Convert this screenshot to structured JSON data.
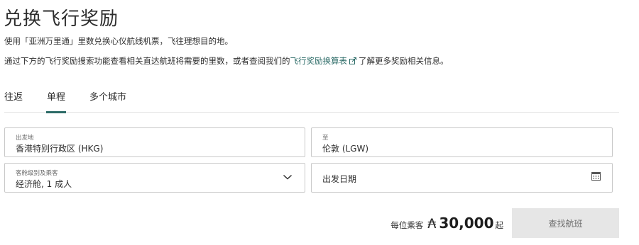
{
  "page": {
    "title": "兑换飞行奖励",
    "intro": "使用「亚洲万里通」里数兑换心仪航线机票，飞往理想目的地。",
    "desc_before": "通过下方的飞行奖励搜索功能查看相关直达航班将需要的里数，或者查阅我们的",
    "desc_link": "飞行奖励换算表",
    "desc_after": "了解更多奖励相关信息。"
  },
  "tabs": [
    {
      "label": "往返",
      "active": false
    },
    {
      "label": "单程",
      "active": true
    },
    {
      "label": "多个城市",
      "active": false
    }
  ],
  "form": {
    "origin": {
      "label": "出发地",
      "value": "香港特别行政区 (HKG)"
    },
    "destination": {
      "label": "至",
      "value": "伦敦 (LGW)"
    },
    "cabin": {
      "label": "客舱级别及乘客",
      "value": "经济舱, 1 成人"
    },
    "date": {
      "placeholder": "出发日期"
    }
  },
  "price": {
    "prefix": "每位乘客",
    "currency_symbol": "₳",
    "amount": "30,000",
    "suffix": "起"
  },
  "search_button": {
    "label": "查找航班"
  },
  "colors": {
    "accent": "#2c6b67",
    "button_bg": "#e6e6e6",
    "border": "#c9c9c9"
  },
  "icons": [
    "external-link-icon",
    "chevron-down-icon",
    "calendar-icon"
  ]
}
